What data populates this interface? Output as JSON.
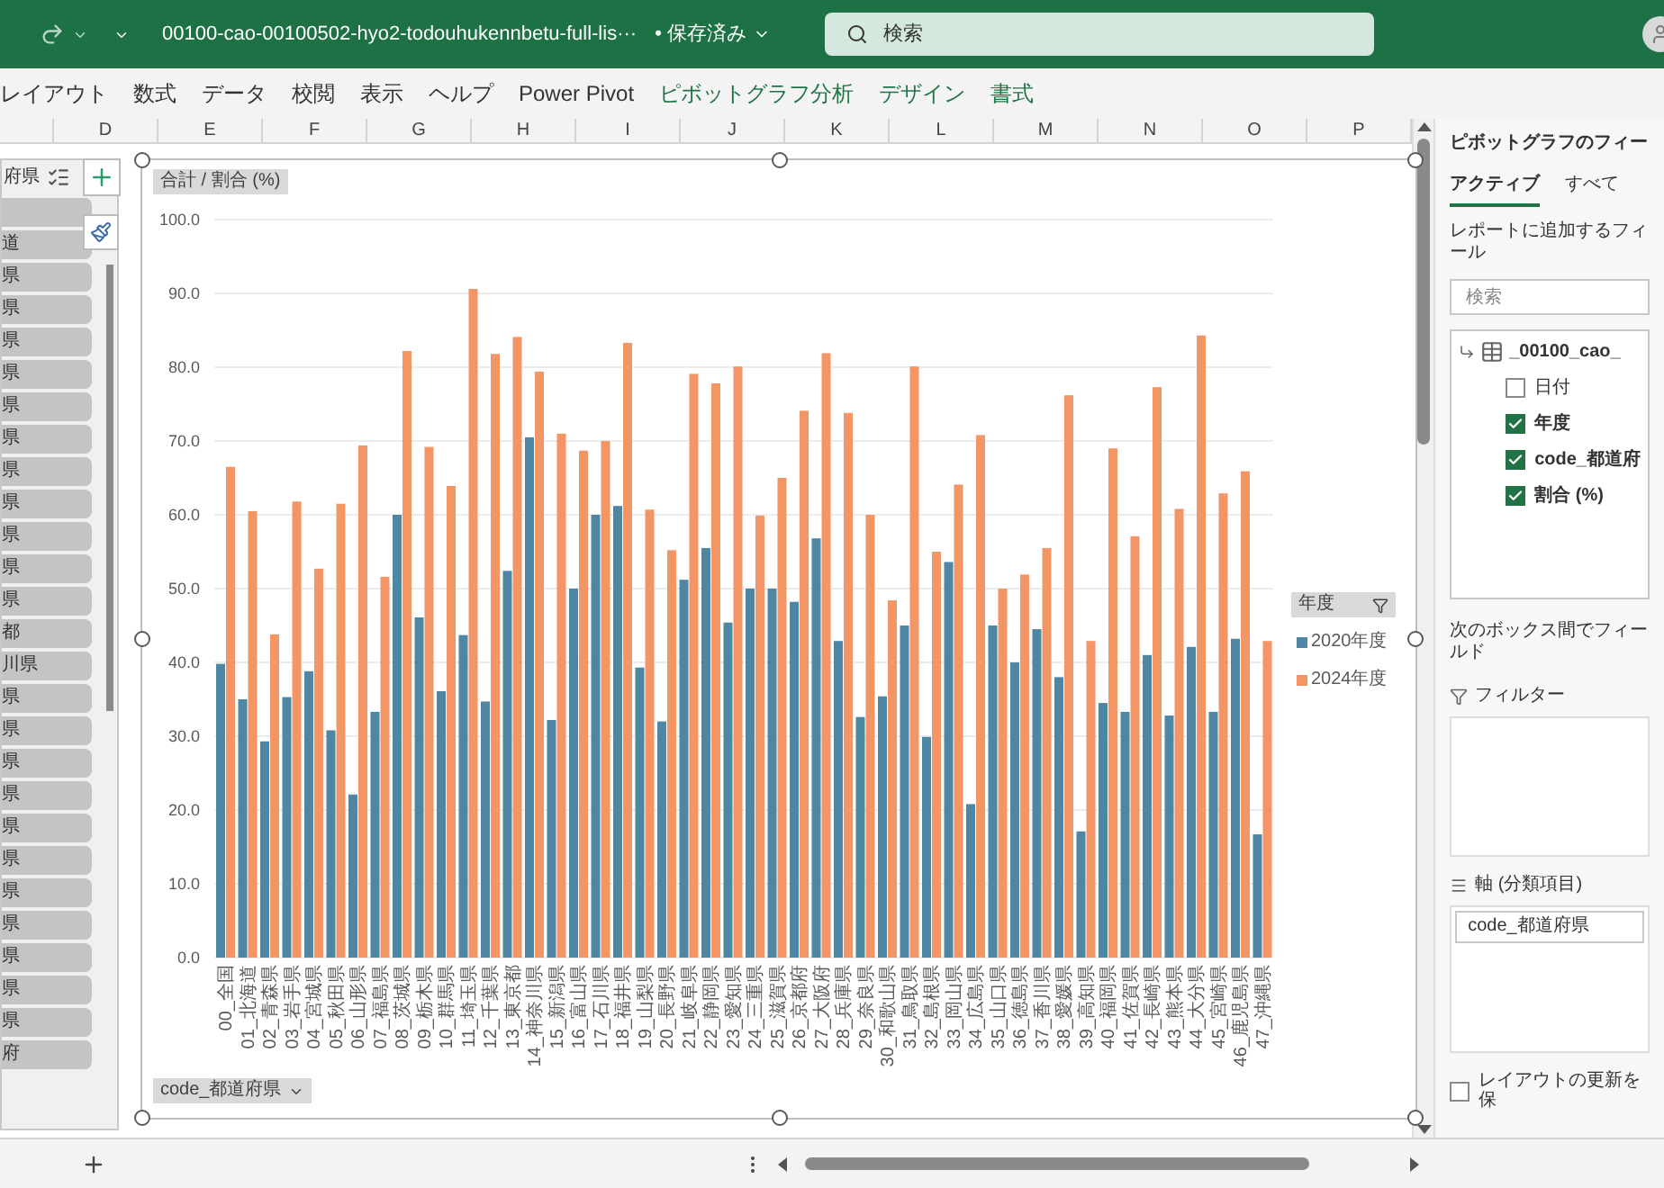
{
  "title_bar": {
    "file_name": "00100-cao-00100502-hyo2-todouhukennbetu-full-lis···",
    "save_status": "• 保存済み",
    "search": {
      "placeholder": "検索"
    }
  },
  "ribbon_tabs": [
    {
      "label": "レイアウト",
      "contextual": false
    },
    {
      "label": "数式",
      "contextual": false
    },
    {
      "label": "データ",
      "contextual": false
    },
    {
      "label": "校閲",
      "contextual": false
    },
    {
      "label": "表示",
      "contextual": false
    },
    {
      "label": "ヘルプ",
      "contextual": false
    },
    {
      "label": "Power Pivot",
      "contextual": false
    },
    {
      "label": "ピボットグラフ分析",
      "contextual": true
    },
    {
      "label": "デザイン",
      "contextual": true
    },
    {
      "label": "書式",
      "contextual": true
    }
  ],
  "column_headers": [
    "D",
    "E",
    "F",
    "G",
    "H",
    "I",
    "J",
    "K",
    "L",
    "M",
    "N",
    "O",
    "P"
  ],
  "slicer": {
    "header": "府県",
    "items": [
      "道",
      "県",
      "県",
      "県",
      "県",
      "県",
      "県",
      "県",
      "県",
      "県",
      "県",
      "県",
      "都",
      "川県",
      "県",
      "県",
      "県",
      "県",
      "県",
      "県",
      "県",
      "県",
      "県",
      "県",
      "県",
      "府"
    ]
  },
  "chart": {
    "value_button": "合計 / 割合 (%)",
    "axis_button": "code_都道府県",
    "legend_button": "年度",
    "chart_data": {
      "type": "bar",
      "categories": [
        "00_全国",
        "01_北海道",
        "02_青森県",
        "03_岩手県",
        "04_宮城県",
        "05_秋田県",
        "06_山形県",
        "07_福島県",
        "08_茨城県",
        "09_栃木県",
        "10_群馬県",
        "11_埼玉県",
        "12_千葉県",
        "13_東京都",
        "14_神奈川県",
        "15_新潟県",
        "16_富山県",
        "17_石川県",
        "18_福井県",
        "19_山梨県",
        "20_長野県",
        "21_岐阜県",
        "22_静岡県",
        "23_愛知県",
        "24_三重県",
        "25_滋賀県",
        "26_京都府",
        "27_大阪府",
        "28_兵庫県",
        "29_奈良県",
        "30_和歌山県",
        "31_鳥取県",
        "32_島根県",
        "33_岡山県",
        "34_広島県",
        "35_山口県",
        "36_徳島県",
        "37_香川県",
        "38_愛媛県",
        "39_高知県",
        "40_福岡県",
        "41_佐賀県",
        "42_長崎県",
        "43_熊本県",
        "44_大分県",
        "45_宮崎県",
        "46_鹿児島県",
        "47_沖縄県"
      ],
      "series": [
        {
          "name": "2020年度",
          "color": "#4f86a3",
          "values": [
            39.8,
            35,
            29.3,
            35.3,
            38.8,
            30.8,
            22.1,
            33.3,
            60,
            46.1,
            36.1,
            43.7,
            34.7,
            52.4,
            70.5,
            32.2,
            50,
            60,
            61.2,
            39.3,
            32,
            51.2,
            55.5,
            45.4,
            50,
            50,
            48.2,
            56.8,
            42.9,
            32.6,
            35.4,
            45,
            29.9,
            53.6,
            20.8,
            45,
            40,
            44.5,
            38,
            17.1,
            34.5,
            33.3,
            41,
            32.8,
            42.1,
            33.3,
            43.2,
            16.7
          ]
        },
        {
          "name": "2024年度",
          "color": "#f39564",
          "values": [
            66.5,
            60.5,
            43.8,
            61.8,
            52.7,
            61.5,
            69.4,
            51.6,
            82.2,
            69.2,
            63.9,
            90.6,
            81.8,
            84.1,
            79.4,
            71,
            68.7,
            70,
            83.3,
            60.7,
            55.2,
            79.1,
            77.8,
            80.1,
            59.9,
            65,
            74.1,
            81.9,
            73.8,
            60,
            48.4,
            80.1,
            55,
            64.1,
            70.8,
            50,
            51.9,
            55.5,
            76.2,
            42.9,
            69,
            57.1,
            77.3,
            60.8,
            84.3,
            62.9,
            65.9,
            42.9
          ]
        }
      ],
      "ylim": [
        0,
        100
      ],
      "grid": true,
      "yticks": [
        {
          "value": 0,
          "label": "0.0"
        },
        {
          "value": 10,
          "label": "10.0"
        },
        {
          "value": 20,
          "label": "20.0"
        },
        {
          "value": 30,
          "label": "30.0"
        },
        {
          "value": 40,
          "label": "40.0"
        },
        {
          "value": 50,
          "label": "50.0"
        },
        {
          "value": 60,
          "label": "60.0"
        },
        {
          "value": 70,
          "label": "70.0"
        },
        {
          "value": 80,
          "label": "80.0"
        },
        {
          "value": 90,
          "label": "90.0"
        },
        {
          "value": 100,
          "label": "100.0"
        }
      ]
    }
  },
  "field_pane": {
    "title": "ピボットグラフのフィー",
    "tabs": [
      {
        "label": "アクティブ",
        "selected": true
      },
      {
        "label": "すべて",
        "selected": false
      }
    ],
    "instruction": "レポートに追加するフィール",
    "search": {
      "placeholder": "検索"
    },
    "table_name": "_00100_cao_",
    "fields": [
      {
        "label": "日付",
        "checked": false
      },
      {
        "label": "年度",
        "checked": true
      },
      {
        "label": "code_都道府",
        "checked": true
      },
      {
        "label": "割合 (%)",
        "checked": true
      }
    ],
    "areas_hint": "次のボックス間でフィールド",
    "filter_label": "フィルター",
    "axis_label": "軸 (分類項目)",
    "axis_fields": [
      "code_都道府県"
    ],
    "defer_update": {
      "label": "レイアウトの更新を保",
      "checked": false
    }
  }
}
